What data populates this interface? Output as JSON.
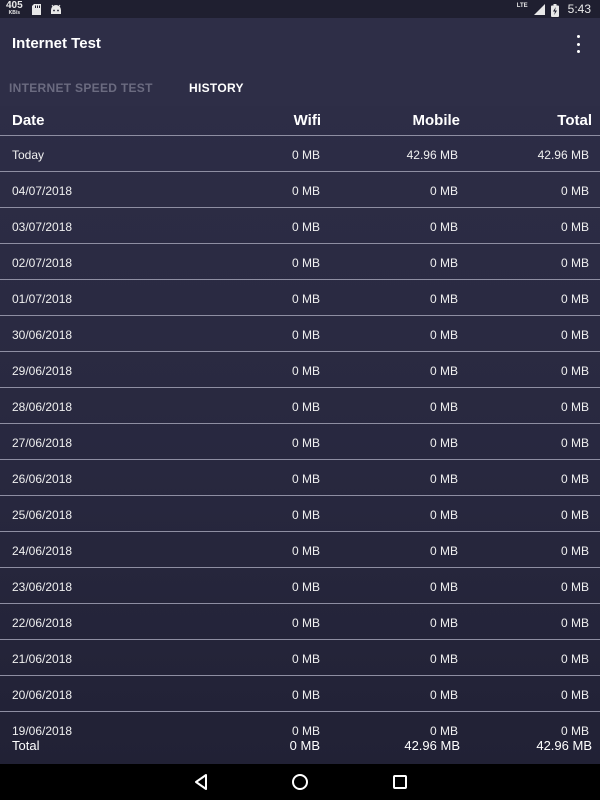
{
  "status_bar": {
    "net_speed_value": "405",
    "net_speed_unit": "KB/s",
    "network_label": "LTE",
    "time": "5:43",
    "icons": [
      "sd-card-icon",
      "android-icon",
      "signal-icon",
      "battery-charging-icon"
    ]
  },
  "app_bar": {
    "title": "Internet Test",
    "menu_icon": "more-vert-icon"
  },
  "tabs": [
    {
      "label": "INTERNET SPEED TEST",
      "active": false
    },
    {
      "label": "HISTORY",
      "active": true
    }
  ],
  "table": {
    "headers": {
      "date": "Date",
      "wifi": "Wifi",
      "mobile": "Mobile",
      "total": "Total"
    },
    "rows": [
      {
        "date": "Today",
        "wifi": "0 MB",
        "mobile": "42.96 MB",
        "total": "42.96 MB"
      },
      {
        "date": "04/07/2018",
        "wifi": "0 MB",
        "mobile": "0 MB",
        "total": "0 MB"
      },
      {
        "date": "03/07/2018",
        "wifi": "0 MB",
        "mobile": "0 MB",
        "total": "0 MB"
      },
      {
        "date": "02/07/2018",
        "wifi": "0 MB",
        "mobile": "0 MB",
        "total": "0 MB"
      },
      {
        "date": "01/07/2018",
        "wifi": "0 MB",
        "mobile": "0 MB",
        "total": "0 MB"
      },
      {
        "date": "30/06/2018",
        "wifi": "0 MB",
        "mobile": "0 MB",
        "total": "0 MB"
      },
      {
        "date": "29/06/2018",
        "wifi": "0 MB",
        "mobile": "0 MB",
        "total": "0 MB"
      },
      {
        "date": "28/06/2018",
        "wifi": "0 MB",
        "mobile": "0 MB",
        "total": "0 MB"
      },
      {
        "date": "27/06/2018",
        "wifi": "0 MB",
        "mobile": "0 MB",
        "total": "0 MB"
      },
      {
        "date": "26/06/2018",
        "wifi": "0 MB",
        "mobile": "0 MB",
        "total": "0 MB"
      },
      {
        "date": "25/06/2018",
        "wifi": "0 MB",
        "mobile": "0 MB",
        "total": "0 MB"
      },
      {
        "date": "24/06/2018",
        "wifi": "0 MB",
        "mobile": "0 MB",
        "total": "0 MB"
      },
      {
        "date": "23/06/2018",
        "wifi": "0 MB",
        "mobile": "0 MB",
        "total": "0 MB"
      },
      {
        "date": "22/06/2018",
        "wifi": "0 MB",
        "mobile": "0 MB",
        "total": "0 MB"
      },
      {
        "date": "21/06/2018",
        "wifi": "0 MB",
        "mobile": "0 MB",
        "total": "0 MB"
      },
      {
        "date": "20/06/2018",
        "wifi": "0 MB",
        "mobile": "0 MB",
        "total": "0 MB"
      },
      {
        "date": "19/06/2018",
        "wifi": "0 MB",
        "mobile": "0 MB",
        "total": "0 MB"
      }
    ],
    "total": {
      "label": "Total",
      "wifi": "0 MB",
      "mobile": "42.96 MB",
      "total": "42.96 MB"
    }
  },
  "nav_bar": {
    "icons": [
      "back-icon",
      "home-icon",
      "recents-icon"
    ]
  },
  "colors": {
    "background": "#2b2b44",
    "status_bar": "#1f1f30",
    "divider": "#8e8ea2",
    "inactive_tab": "#6b6b80",
    "nav_bar": "#000000"
  }
}
